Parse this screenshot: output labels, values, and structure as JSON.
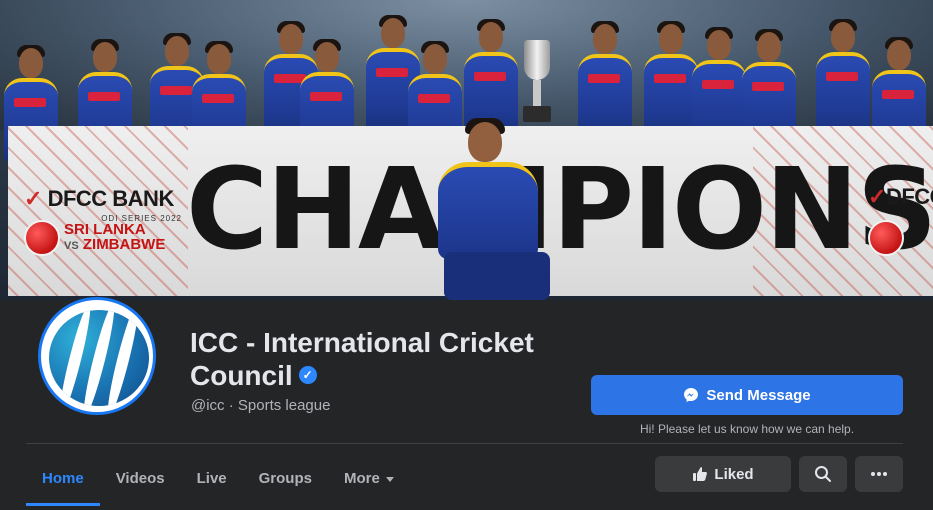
{
  "cover": {
    "banner_headline": "CHAMPIONS",
    "sponsor_name": "DFCC BANK",
    "sponsor_series": "ODI SERIES 2022",
    "matchup_team_a": "SRI LANKA",
    "matchup_vs": "VS",
    "matchup_team_b": "ZIMBABWE",
    "sponsor_name_right": "DFCC",
    "jersey_sponsor": "Dialog"
  },
  "page": {
    "name": "ICC - International Cricket Council",
    "handle_category": "@icc · Sports league",
    "verified_icon": "verified-badge-icon"
  },
  "actions": {
    "send_message_label": "Send Message",
    "helper_text": "Hi! Please let us know how we can help.",
    "liked_label": "Liked",
    "search_icon": "search-icon",
    "more_icon": "more-icon"
  },
  "nav": {
    "tabs": [
      {
        "label": "Home",
        "active": true
      },
      {
        "label": "Videos",
        "active": false
      },
      {
        "label": "Live",
        "active": false
      },
      {
        "label": "Groups",
        "active": false
      },
      {
        "label": "More",
        "active": false
      }
    ]
  },
  "colors": {
    "accent": "#2d88ff",
    "background": "#242526",
    "button": "#3a3b3c",
    "primary_button": "#2d74e6"
  }
}
